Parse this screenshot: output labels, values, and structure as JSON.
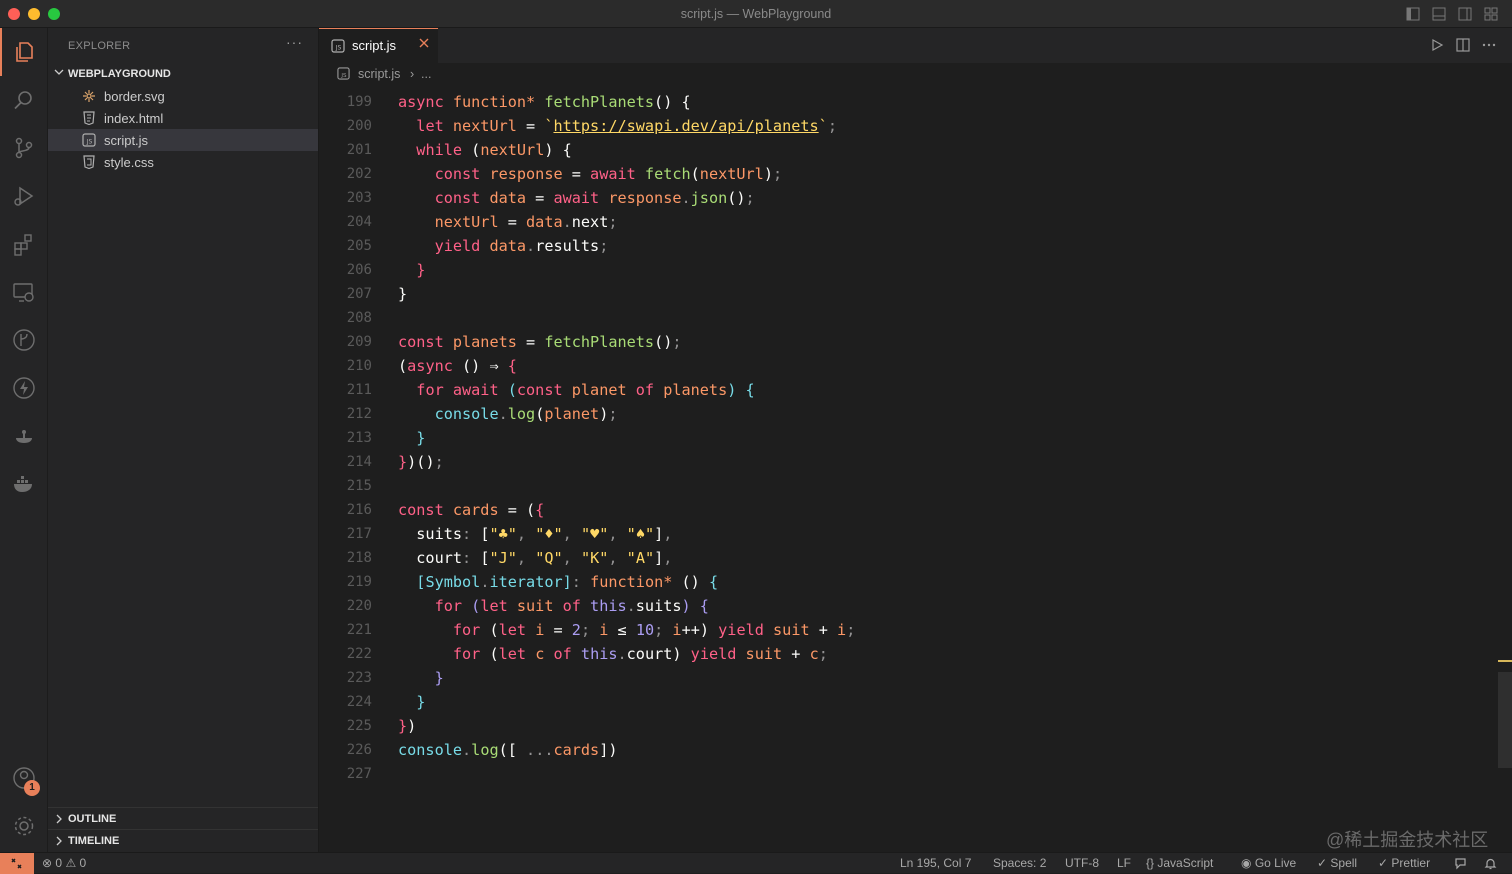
{
  "window": {
    "title": "script.js — WebPlayground"
  },
  "sidebar": {
    "title": "EXPLORER",
    "more": "···",
    "root": "WEBPLAYGROUND",
    "files": [
      {
        "name": "border.svg",
        "icon": "svg-file-icon",
        "selected": false
      },
      {
        "name": "index.html",
        "icon": "html-file-icon",
        "selected": false
      },
      {
        "name": "script.js",
        "icon": "js-file-icon",
        "selected": true
      },
      {
        "name": "style.css",
        "icon": "css-file-icon",
        "selected": false
      }
    ],
    "panels": {
      "outline": "OUTLINE",
      "timeline": "TIMELINE"
    }
  },
  "activity": {
    "accounts_badge": "1"
  },
  "editor": {
    "tab": {
      "label": "script.js"
    },
    "breadcrumb": {
      "file": "script.js",
      "separator": "›",
      "rest": "..."
    },
    "code": {
      "lines": [
        {
          "n": "199",
          "t": [
            [
              "kw",
              "async "
            ],
            [
              "kw2",
              "function* "
            ],
            [
              "fn",
              "fetchPlanets"
            ],
            [
              "var",
              "() {"
            ]
          ]
        },
        {
          "n": "200",
          "t": [
            [
              "var",
              "  "
            ],
            [
              "kw",
              "let "
            ],
            [
              "kw2",
              "nextUrl"
            ],
            [
              "var",
              " = "
            ],
            [
              "str",
              "`"
            ],
            [
              "url",
              "https://swapi.dev/api/planets"
            ],
            [
              "str",
              "`"
            ],
            [
              "punc",
              ";"
            ]
          ]
        },
        {
          "n": "201",
          "t": [
            [
              "var",
              "  "
            ],
            [
              "kw",
              "while "
            ],
            [
              "var",
              "("
            ],
            [
              "kw2",
              "nextUrl"
            ],
            [
              "var",
              ") {"
            ]
          ]
        },
        {
          "n": "202",
          "t": [
            [
              "var",
              "    "
            ],
            [
              "kw",
              "const "
            ],
            [
              "kw2",
              "response"
            ],
            [
              "var",
              " = "
            ],
            [
              "kw",
              "await "
            ],
            [
              "fn",
              "fetch"
            ],
            [
              "var",
              "("
            ],
            [
              "kw2",
              "nextUrl"
            ],
            [
              "var",
              ")"
            ],
            [
              "punc",
              ";"
            ]
          ]
        },
        {
          "n": "203",
          "t": [
            [
              "var",
              "    "
            ],
            [
              "kw",
              "const "
            ],
            [
              "kw2",
              "data"
            ],
            [
              "var",
              " = "
            ],
            [
              "kw",
              "await "
            ],
            [
              "kw2",
              "response"
            ],
            [
              "punc",
              "."
            ],
            [
              "fn",
              "json"
            ],
            [
              "var",
              "()"
            ],
            [
              "punc",
              ";"
            ]
          ]
        },
        {
          "n": "204",
          "t": [
            [
              "var",
              "    "
            ],
            [
              "kw2",
              "nextUrl"
            ],
            [
              "var",
              " = "
            ],
            [
              "kw2",
              "data"
            ],
            [
              "punc",
              "."
            ],
            [
              "var",
              "next"
            ],
            [
              "punc",
              ";"
            ]
          ]
        },
        {
          "n": "205",
          "t": [
            [
              "var",
              "    "
            ],
            [
              "kw",
              "yield "
            ],
            [
              "kw2",
              "data"
            ],
            [
              "punc",
              "."
            ],
            [
              "var",
              "results"
            ],
            [
              "punc",
              ";"
            ]
          ]
        },
        {
          "n": "206",
          "t": [
            [
              "var",
              "  "
            ],
            [
              "kw",
              "}"
            ]
          ]
        },
        {
          "n": "207",
          "t": [
            [
              "var",
              "}"
            ]
          ]
        },
        {
          "n": "208",
          "t": []
        },
        {
          "n": "209",
          "t": [
            [
              "kw",
              "const "
            ],
            [
              "kw2",
              "planets"
            ],
            [
              "var",
              " = "
            ],
            [
              "fn",
              "fetchPlanets"
            ],
            [
              "var",
              "()"
            ],
            [
              "punc",
              ";"
            ]
          ]
        },
        {
          "n": "210",
          "t": [
            [
              "var",
              "("
            ],
            [
              "kw",
              "async "
            ],
            [
              "var",
              "() ⇒ "
            ],
            [
              "kw",
              "{"
            ]
          ]
        },
        {
          "n": "211",
          "t": [
            [
              "var",
              "  "
            ],
            [
              "kw",
              "for await "
            ],
            [
              "prop",
              "("
            ],
            [
              "kw",
              "const "
            ],
            [
              "kw2",
              "planet"
            ],
            [
              "kw",
              " of "
            ],
            [
              "kw2",
              "planets"
            ],
            [
              "prop",
              ") {"
            ]
          ]
        },
        {
          "n": "212",
          "t": [
            [
              "var",
              "    "
            ],
            [
              "prop",
              "console"
            ],
            [
              "punc",
              "."
            ],
            [
              "fn",
              "log"
            ],
            [
              "var",
              "("
            ],
            [
              "kw2",
              "planet"
            ],
            [
              "var",
              ")"
            ],
            [
              "punc",
              ";"
            ]
          ]
        },
        {
          "n": "213",
          "t": [
            [
              "var",
              "  "
            ],
            [
              "prop",
              "}"
            ]
          ]
        },
        {
          "n": "214",
          "t": [
            [
              "kw",
              "}"
            ],
            [
              "var",
              ")()"
            ],
            [
              "punc",
              ";"
            ]
          ]
        },
        {
          "n": "215",
          "t": []
        },
        {
          "n": "216",
          "t": [
            [
              "kw",
              "const "
            ],
            [
              "kw2",
              "cards"
            ],
            [
              "var",
              " = ("
            ],
            [
              "kw",
              "{"
            ]
          ]
        },
        {
          "n": "217",
          "t": [
            [
              "var",
              "  suits"
            ],
            [
              "punc",
              ": "
            ],
            [
              "var",
              "["
            ],
            [
              "str",
              "\"♣\""
            ],
            [
              "punc",
              ", "
            ],
            [
              "str",
              "\"♦\""
            ],
            [
              "punc",
              ", "
            ],
            [
              "str",
              "\"♥\""
            ],
            [
              "punc",
              ", "
            ],
            [
              "str",
              "\"♠\""
            ],
            [
              "var",
              "]"
            ],
            [
              "punc",
              ","
            ]
          ]
        },
        {
          "n": "218",
          "t": [
            [
              "var",
              "  court"
            ],
            [
              "punc",
              ": "
            ],
            [
              "var",
              "["
            ],
            [
              "str",
              "\"J\""
            ],
            [
              "punc",
              ", "
            ],
            [
              "str",
              "\"Q\""
            ],
            [
              "punc",
              ", "
            ],
            [
              "str",
              "\"K\""
            ],
            [
              "punc",
              ", "
            ],
            [
              "str",
              "\"A\""
            ],
            [
              "var",
              "]"
            ],
            [
              "punc",
              ","
            ]
          ]
        },
        {
          "n": "219",
          "t": [
            [
              "var",
              "  "
            ],
            [
              "prop",
              "["
            ],
            [
              "prop",
              "Symbol"
            ],
            [
              "punc",
              "."
            ],
            [
              "prop",
              "iterator"
            ],
            [
              "prop",
              "]"
            ],
            [
              "punc",
              ": "
            ],
            [
              "kw2",
              "function* "
            ],
            [
              "var",
              "() "
            ],
            [
              "prop",
              "{"
            ]
          ]
        },
        {
          "n": "220",
          "t": [
            [
              "var",
              "    "
            ],
            [
              "kw",
              "for "
            ],
            [
              "num",
              "("
            ],
            [
              "kw",
              "let "
            ],
            [
              "kw2",
              "suit"
            ],
            [
              "kw",
              " of "
            ],
            [
              "num",
              "this"
            ],
            [
              "punc",
              "."
            ],
            [
              "var",
              "suits"
            ],
            [
              "num",
              ") {"
            ]
          ]
        },
        {
          "n": "221",
          "t": [
            [
              "var",
              "      "
            ],
            [
              "kw",
              "for "
            ],
            [
              "var",
              "("
            ],
            [
              "kw",
              "let "
            ],
            [
              "kw2",
              "i"
            ],
            [
              "var",
              " = "
            ],
            [
              "num",
              "2"
            ],
            [
              "punc",
              "; "
            ],
            [
              "kw2",
              "i"
            ],
            [
              "var",
              " ≤ "
            ],
            [
              "num",
              "10"
            ],
            [
              "punc",
              "; "
            ],
            [
              "kw2",
              "i"
            ],
            [
              "var",
              "++) "
            ],
            [
              "kw",
              "yield "
            ],
            [
              "kw2",
              "suit"
            ],
            [
              "var",
              " + "
            ],
            [
              "kw2",
              "i"
            ],
            [
              "punc",
              ";"
            ]
          ]
        },
        {
          "n": "222",
          "t": [
            [
              "var",
              "      "
            ],
            [
              "kw",
              "for "
            ],
            [
              "var",
              "("
            ],
            [
              "kw",
              "let "
            ],
            [
              "kw2",
              "c"
            ],
            [
              "kw",
              " of "
            ],
            [
              "num",
              "this"
            ],
            [
              "punc",
              "."
            ],
            [
              "var",
              "court) "
            ],
            [
              "kw",
              "yield "
            ],
            [
              "kw2",
              "suit"
            ],
            [
              "var",
              " + "
            ],
            [
              "kw2",
              "c"
            ],
            [
              "punc",
              ";"
            ]
          ]
        },
        {
          "n": "223",
          "t": [
            [
              "var",
              "    "
            ],
            [
              "num",
              "}"
            ]
          ]
        },
        {
          "n": "224",
          "t": [
            [
              "var",
              "  "
            ],
            [
              "prop",
              "}"
            ]
          ]
        },
        {
          "n": "225",
          "t": [
            [
              "kw",
              "}"
            ],
            [
              "var",
              ")"
            ]
          ]
        },
        {
          "n": "226",
          "t": [
            [
              "prop",
              "console"
            ],
            [
              "punc",
              "."
            ],
            [
              "fn",
              "log"
            ],
            [
              "var",
              "([ "
            ],
            [
              "punc",
              "..."
            ],
            [
              "kw2",
              "cards"
            ],
            [
              "var",
              "])"
            ]
          ]
        },
        {
          "n": "227",
          "t": []
        }
      ]
    }
  },
  "statusbar": {
    "errors": "0",
    "warnings": "0",
    "position": "Ln 195, Col 7",
    "spaces": "Spaces: 2",
    "encoding": "UTF-8",
    "eol": "LF",
    "language": "JavaScript",
    "golive": "Go Live",
    "spell": "Spell",
    "prettier": "Prettier"
  },
  "watermark": "@稀土掘金技术社区",
  "colors": {
    "accent": "#e8805a",
    "keyword": "#ff6188",
    "function": "#a9dc76",
    "string": "#ffd866"
  }
}
